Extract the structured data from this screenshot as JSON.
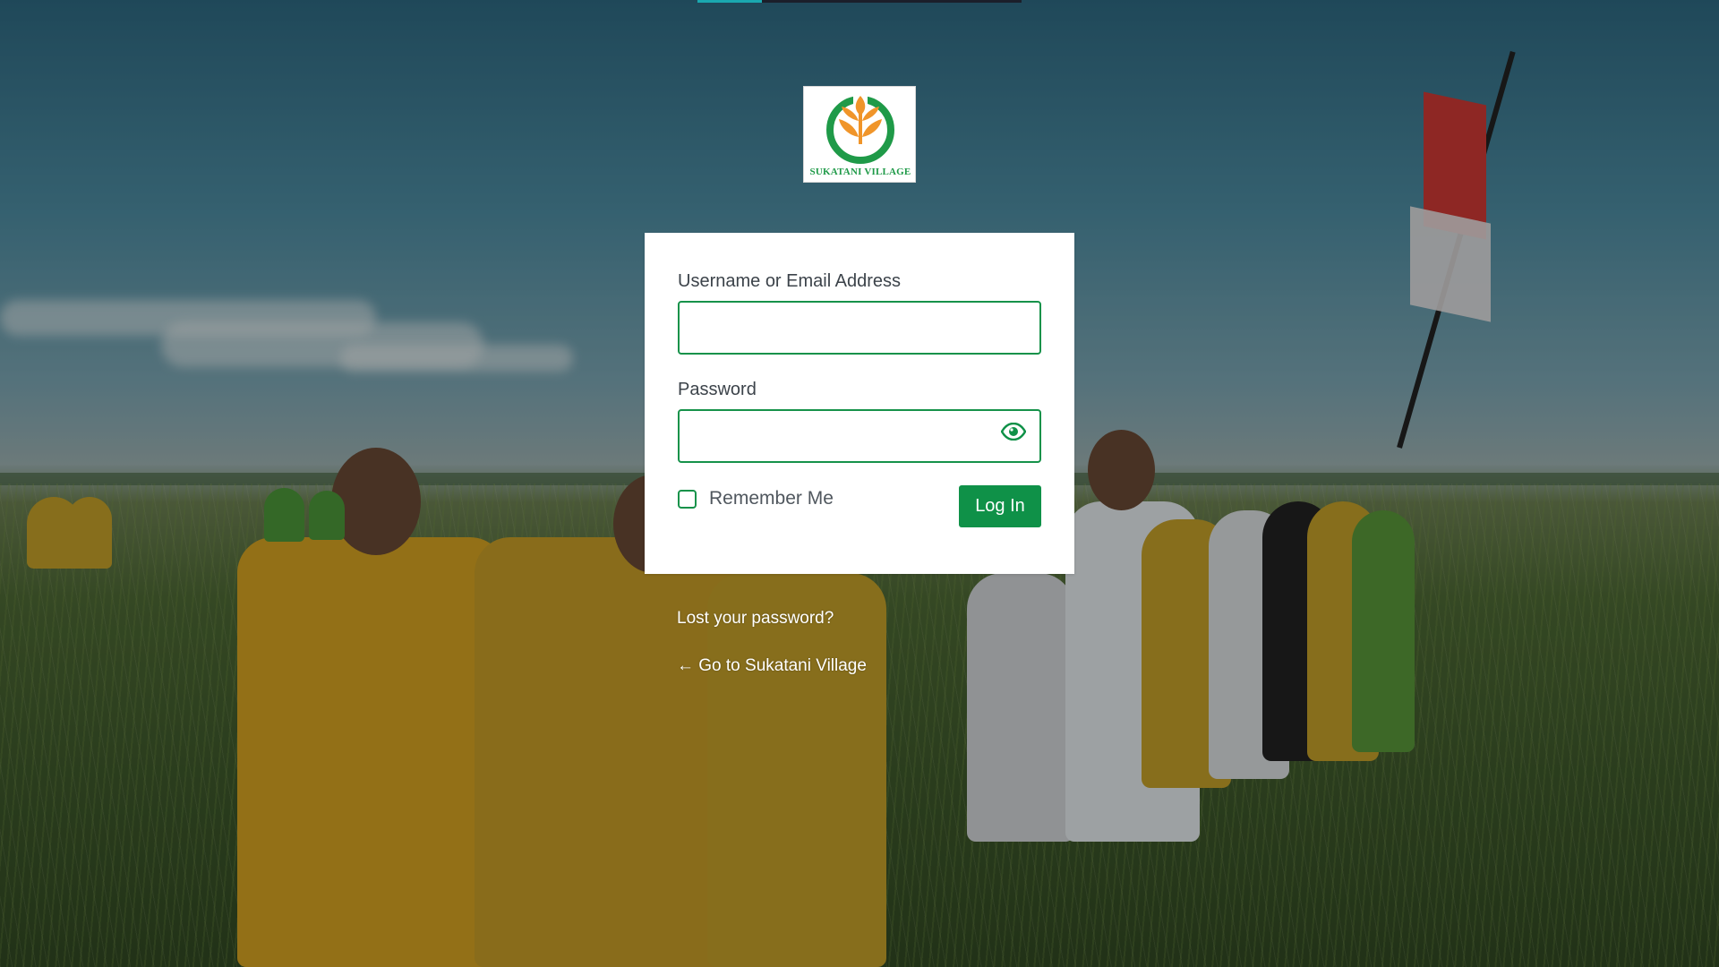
{
  "brand": {
    "name": "SUKATANI VILLAGE",
    "accent_color": "#0f9148",
    "logo_colors": {
      "ring": "#1f9a48",
      "leaf": "#f0952a"
    }
  },
  "form": {
    "username_label": "Username or Email Address",
    "username_value": "",
    "password_label": "Password",
    "password_value": "",
    "show_password_icon": "eye-icon",
    "remember_label": "Remember Me",
    "remember_checked": false,
    "submit_label": "Log In"
  },
  "links": {
    "lost_password": "Lost your password?",
    "back_to_site": "← Go to Sukatani Village"
  }
}
